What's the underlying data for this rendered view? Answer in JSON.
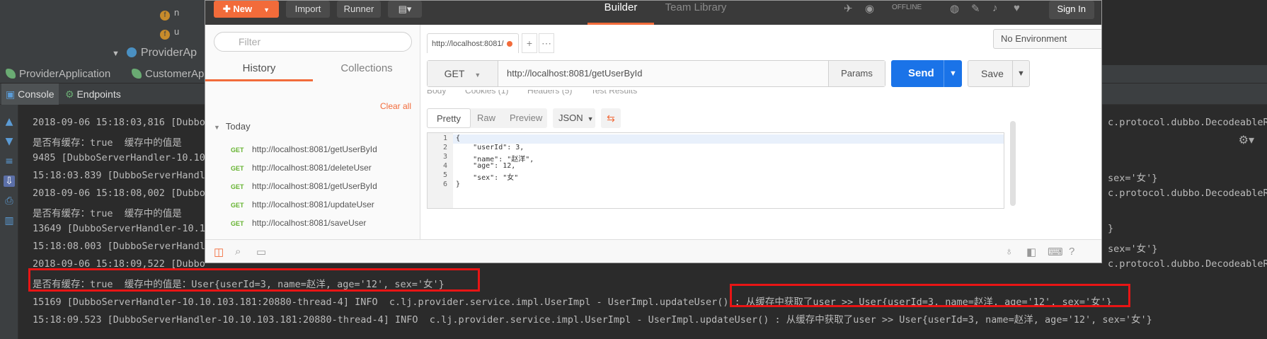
{
  "ide": {
    "tree_items": [
      {
        "label": "n",
        "icon": "f"
      },
      {
        "label": "u",
        "icon": "f"
      }
    ],
    "tree_node": "ProviderAp",
    "run_tabs": [
      "ProviderApplication",
      "CustomerAp"
    ],
    "sub_tabs": [
      "Console",
      "Endpoints"
    ],
    "console_lines": [
      "2018-09-06 15:18:03,816 [Dubbo",
      "是否有缓存：true  缓存中的值是",
      "9485 [DubboServerHandler-10.10",
      "15:18:03.839 [DubboServerHandl",
      "2018-09-06 15:18:08,002 [Dubbo",
      "是否有缓存：true  缓存中的值是",
      "13649 [DubboServerHandler-10.1",
      "15:18:08.003 [DubboServerHandl",
      "2018-09-06 15:18:09,522 [Dubbo",
      "是否有缓存：true  缓存中的值是：User{userId=3, name=赵洋, age='12', sex='女'}",
      "15169 [DubboServerHandler-10.10.103.181:20880-thread-4] INFO  c.lj.provider.service.impl.UserImpl - UserImpl.updateUser() : 从缓存中获取了user >> User{userId=3, name=赵洋, age='12', sex='女'}",
      "15:18:09.523 [DubboServerHandler-10.10.103.181:20880-thread-4] INFO  c.lj.provider.service.impl.UserImpl - UserImpl.updateUser() : 从缓存中获取了user >> User{userId=3, name=赵洋, age='12', sex='女'}"
    ],
    "right_lines": [
      "c.protocol.dubbo.DecodeableR",
      "sex='女'}",
      "c.protocol.dubbo.DecodeableR",
      "}",
      "sex='女'}",
      "c.protocol.dubbo.DecodeableR"
    ]
  },
  "postman": {
    "header": {
      "new_label": "New",
      "import_label": "Import",
      "runner_label": "Runner",
      "tab_builder": "Builder",
      "tab_team_library": "Team Library",
      "offline_label": "OFFLINE",
      "sign_in_label": "Sign In"
    },
    "sidebar": {
      "filter_placeholder": "Filter",
      "tab_history": "History",
      "tab_collections": "Collections",
      "clear_all": "Clear all",
      "today": "Today",
      "items": [
        {
          "method": "GET",
          "url": "http://localhost:8081/getUserById"
        },
        {
          "method": "GET",
          "url": "http://localhost:8081/deleteUser"
        },
        {
          "method": "GET",
          "url": "http://localhost:8081/getUserById"
        },
        {
          "method": "GET",
          "url": "http://localhost:8081/updateUser"
        },
        {
          "method": "GET",
          "url": "http://localhost:8081/saveUser"
        }
      ]
    },
    "request": {
      "tab_label": "http://localhost:8081/",
      "environment": "No Environment",
      "method": "GET",
      "url": "http://localhost:8081/getUserById",
      "params_label": "Params",
      "send_label": "Send",
      "save_label": "Save"
    },
    "response": {
      "tabs_partial": "Body        Cookies (1)        Headers (5)        Test Results",
      "view_modes": [
        "Pretty",
        "Raw",
        "Preview"
      ],
      "format": "JSON",
      "line_numbers": [
        "1",
        "2",
        "3",
        "4",
        "5",
        "6"
      ],
      "code_lines": [
        "{",
        "    \"userId\": 3,",
        "    \"name\": \"赵洋\",",
        "    \"age\": 12,",
        "    \"sex\": \"女\"",
        "}"
      ]
    }
  },
  "colors": {
    "accent": "#f26b3a",
    "send_blue": "#1a73e8",
    "highlight_box": "#e81515",
    "get_green": "#65b330"
  }
}
